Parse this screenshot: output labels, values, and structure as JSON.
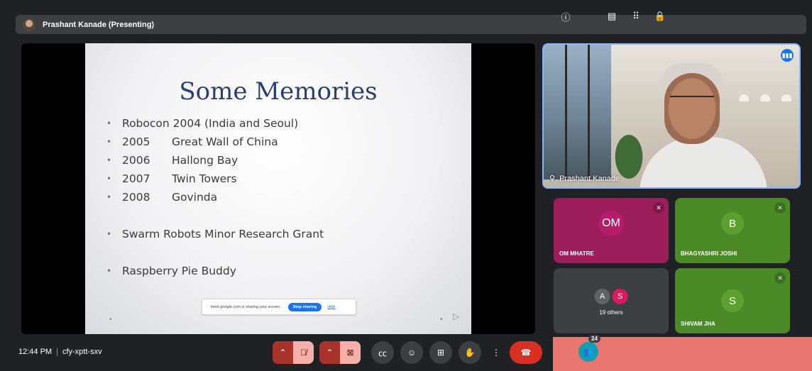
{
  "presenter": {
    "name": "Prashant Kanade (Presenting)"
  },
  "slide": {
    "title": "Some Memories",
    "bullets": [
      {
        "year": "",
        "text": "Robocon 2004 (India and Seoul)"
      },
      {
        "year": "2005",
        "text": "Great Wall of China"
      },
      {
        "year": "2006",
        "text": "Hallong Bay"
      },
      {
        "year": "2007",
        "text": "Twin Towers"
      },
      {
        "year": "2008",
        "text": "Govinda"
      },
      {
        "year": "",
        "text": "Swarm Robots Minor Research Grant"
      },
      {
        "year": "",
        "text": "Raspberry Pie Buddy"
      }
    ],
    "share_notice": {
      "message": "meet.google.com is sharing your screen.",
      "stop_label": "Stop sharing",
      "hide_label": "Hide"
    }
  },
  "main_video": {
    "name": "Prashant Kanade"
  },
  "participants": {
    "om": {
      "initials": "OM",
      "name": "OM MHATRE"
    },
    "bj": {
      "initials": "B",
      "name": "BHAGYASHRI JOSHI"
    },
    "others": {
      "initial_a": "A",
      "initial_b": "S",
      "label": "19 others"
    },
    "sj": {
      "initials": "S",
      "name": "SHIVAM JHA"
    }
  },
  "meeting": {
    "time": "12:44 PM",
    "code": "cfy-xptt-sxv",
    "participant_count": "24"
  },
  "colors": {
    "accent": "#1a73e8",
    "end_call": "#d93025",
    "teal": "#129eaf",
    "panel_highlight": "#ea7672"
  },
  "icons": {
    "mic": "mic-off-icon",
    "camera": "videocam-off-icon",
    "captions": "closed-caption-icon",
    "emoji": "emoji-icon",
    "present": "present-screen-icon",
    "hand": "raise-hand-icon",
    "more": "more-vert-icon",
    "end": "call-end-icon",
    "info": "info-icon",
    "people": "people-icon",
    "chat": "chat-icon",
    "activities": "apps-icon",
    "host": "host-controls-icon"
  }
}
